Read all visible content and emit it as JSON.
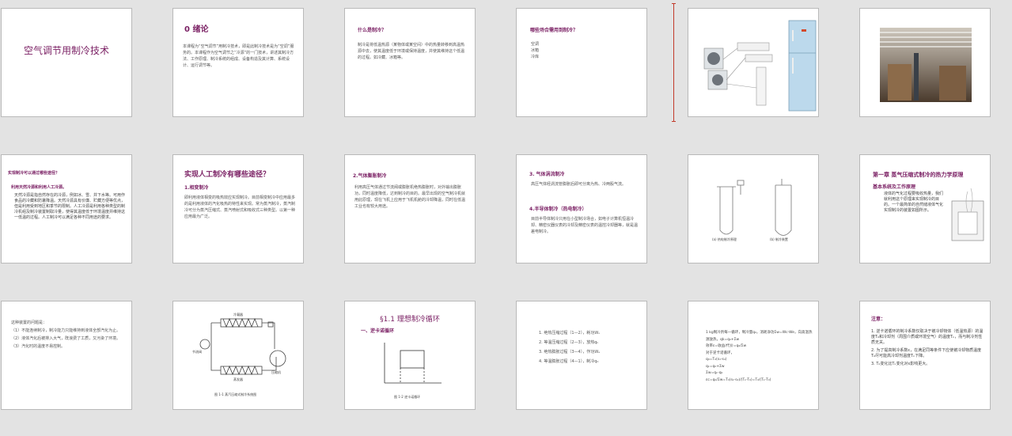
{
  "slides": [
    {
      "title": "空气调节用制冷技术"
    },
    {
      "title": "0 绪论",
      "body": "本课程为“空气调节”用制冷技术，即是此制冷技术是为“空调”服务的。本课程作为空气调节之“冷源”的一门技术，讲述其制冷方法、工作原理、制冷系统的组成、设备构造及其计算、系统设计、运行调节等。"
    },
    {
      "title": "什么是制冷？",
      "body": "制冷是将低温热源（某物体或某空间）中的热量转移到高温热源中去，使其温度低于环境或保持温度，并使其维持这个低温的过程。如冷藏、冰箱等。"
    },
    {
      "title": "哪些场合需用到制冷？",
      "items": [
        "空调",
        "冰箱",
        "冷库"
      ]
    },
    {
      "title": "",
      "caption": ""
    },
    {
      "title": ""
    },
    {
      "title": "实现制冷可以通过哪些途径？",
      "bullet": "利用天然冷源和利用人工冷源。",
      "body": "天然冷源是指自然存在的冷源，例如冰、雪、井下水等。可用作食品的冷藏和防暑降温。天然冷源具有价廉、贮藏方便等优点，但是利用受到地区和季节的限制。人工冷源是利用各种类型的制冷机组及制冷装置制取冷量，使得其温度低于环境温度并维持这一低温的过程。人工制冷可以满足各种不同用途的要求。"
    },
    {
      "title": "实现人工制冷有哪些途径？",
      "sub": "1.相变制冷",
      "body": "即利用液体相变的吸热效应实现制冷。目前相变制冷中应用最多的是利用液体的汽化吸热的特性来实现。常为蒸汽制冷，蒸汽制冷可分为蒸汽压缩式、蒸汽喷射式和吸收式三种类型。以第一种应用最为广泛。"
    },
    {
      "title": "2.气体膨胀制冷",
      "body": "利用高压气体通过节流阀或膨胀机绝热膨胀时，对外输出膨胀功，同时温度降低，达到制冷的目的。最早出现的空气制冷机就用此原理，现在飞机上应用于飞机机舱的冷却降温，同时在低温工业也有较大用途。"
    },
    {
      "title": "3. 气体涡流制冷",
      "body": "高压气体经涡流管膨胀后即可分离为热、冷两股气流。",
      "title2": "4.半导体制冷（热电制冷）",
      "body2": "目前半导体制冷只用在小型制冷场合，如电子计算机恒温冷却、精密仪器仪表的冷却及精密仪表的温控冷却器等，就是温差电制冷。"
    },
    {
      "caption1": "(a) 热电制冷原理",
      "caption2": "(b) 制冷装置"
    },
    {
      "title": "第一章 蒸气压缩式制冷的热力学原理",
      "sub": "基本系统及工作原理",
      "body": "液体的气化过程要吸收热量，我们就利用这个原理来实现制冷的目的。一个最简单的自然储液体气化实现制冷的装置如图所示。"
    },
    {
      "body": "这种装置的问题是：\n（1）不能连续制冷，制冷能力只能维持到液体全部汽化为止。\n（2）液体汽化后被排入大气，既浪费了工质，又污染了环境。\n（3）汽化时的温度不易控制。"
    },
    {
      "caption": "图 1-1 蒸汽压缩式制冷系统图",
      "labels": [
        "冷凝器",
        "节流阀",
        "蒸发器",
        "压缩机"
      ]
    },
    {
      "title": "§1.1 理想制冷循环",
      "sub": "一、逆卡诺循环",
      "caption": "图 1-2 逆卡诺循环"
    },
    {
      "items": [
        "1. 绝热压缩过程（1—2），耗功Wₒ",
        "2. 等温压缩过程（2—3），放热qₖ",
        "3. 绝热膨胀过程（3—4），作功Wₑ",
        "4. 等温膨胀过程（4—1），制冷q₀"
      ]
    },
    {
      "lines": [
        "1 kg制冷剂每一循环，制冷量q₀，消耗净功Σw=Wc-We，向高温热源放热，qk=q₀+Σw",
        "效率ε=收益/代价=q₀/Σw",
        "对于逆卡诺循环，",
        "q₀=T₀(s₁-s₄)",
        "qₖ=q₀+Σw",
        "Σw=qₖ-q₀",
        "εc=q₀/Σw=T₀(s₁-s₄)/(Tₖ-T₀)=T₀/(Tₖ-T₀)"
      ]
    },
    {
      "title": "注意：",
      "items": [
        "1. 逆卡诺循环的制冷系数仅取决于被冷却物体（低温热源）的温度T₀和冷却剂（周围介质或环境空气）的温度Tₖ，而与制冷剂性质无关。",
        "2. 为了提高制冷系数ε，在满足同等条件下应使被冷却物质温度T₀尽可能高冷却剂温度Tₖ下降。",
        "3. T₀变化比Tₖ变化对ε影响更大。"
      ]
    }
  ],
  "colors": {
    "title": "#7a1f63",
    "background": "#e3e3e3",
    "cursor": "#c23a2b"
  }
}
